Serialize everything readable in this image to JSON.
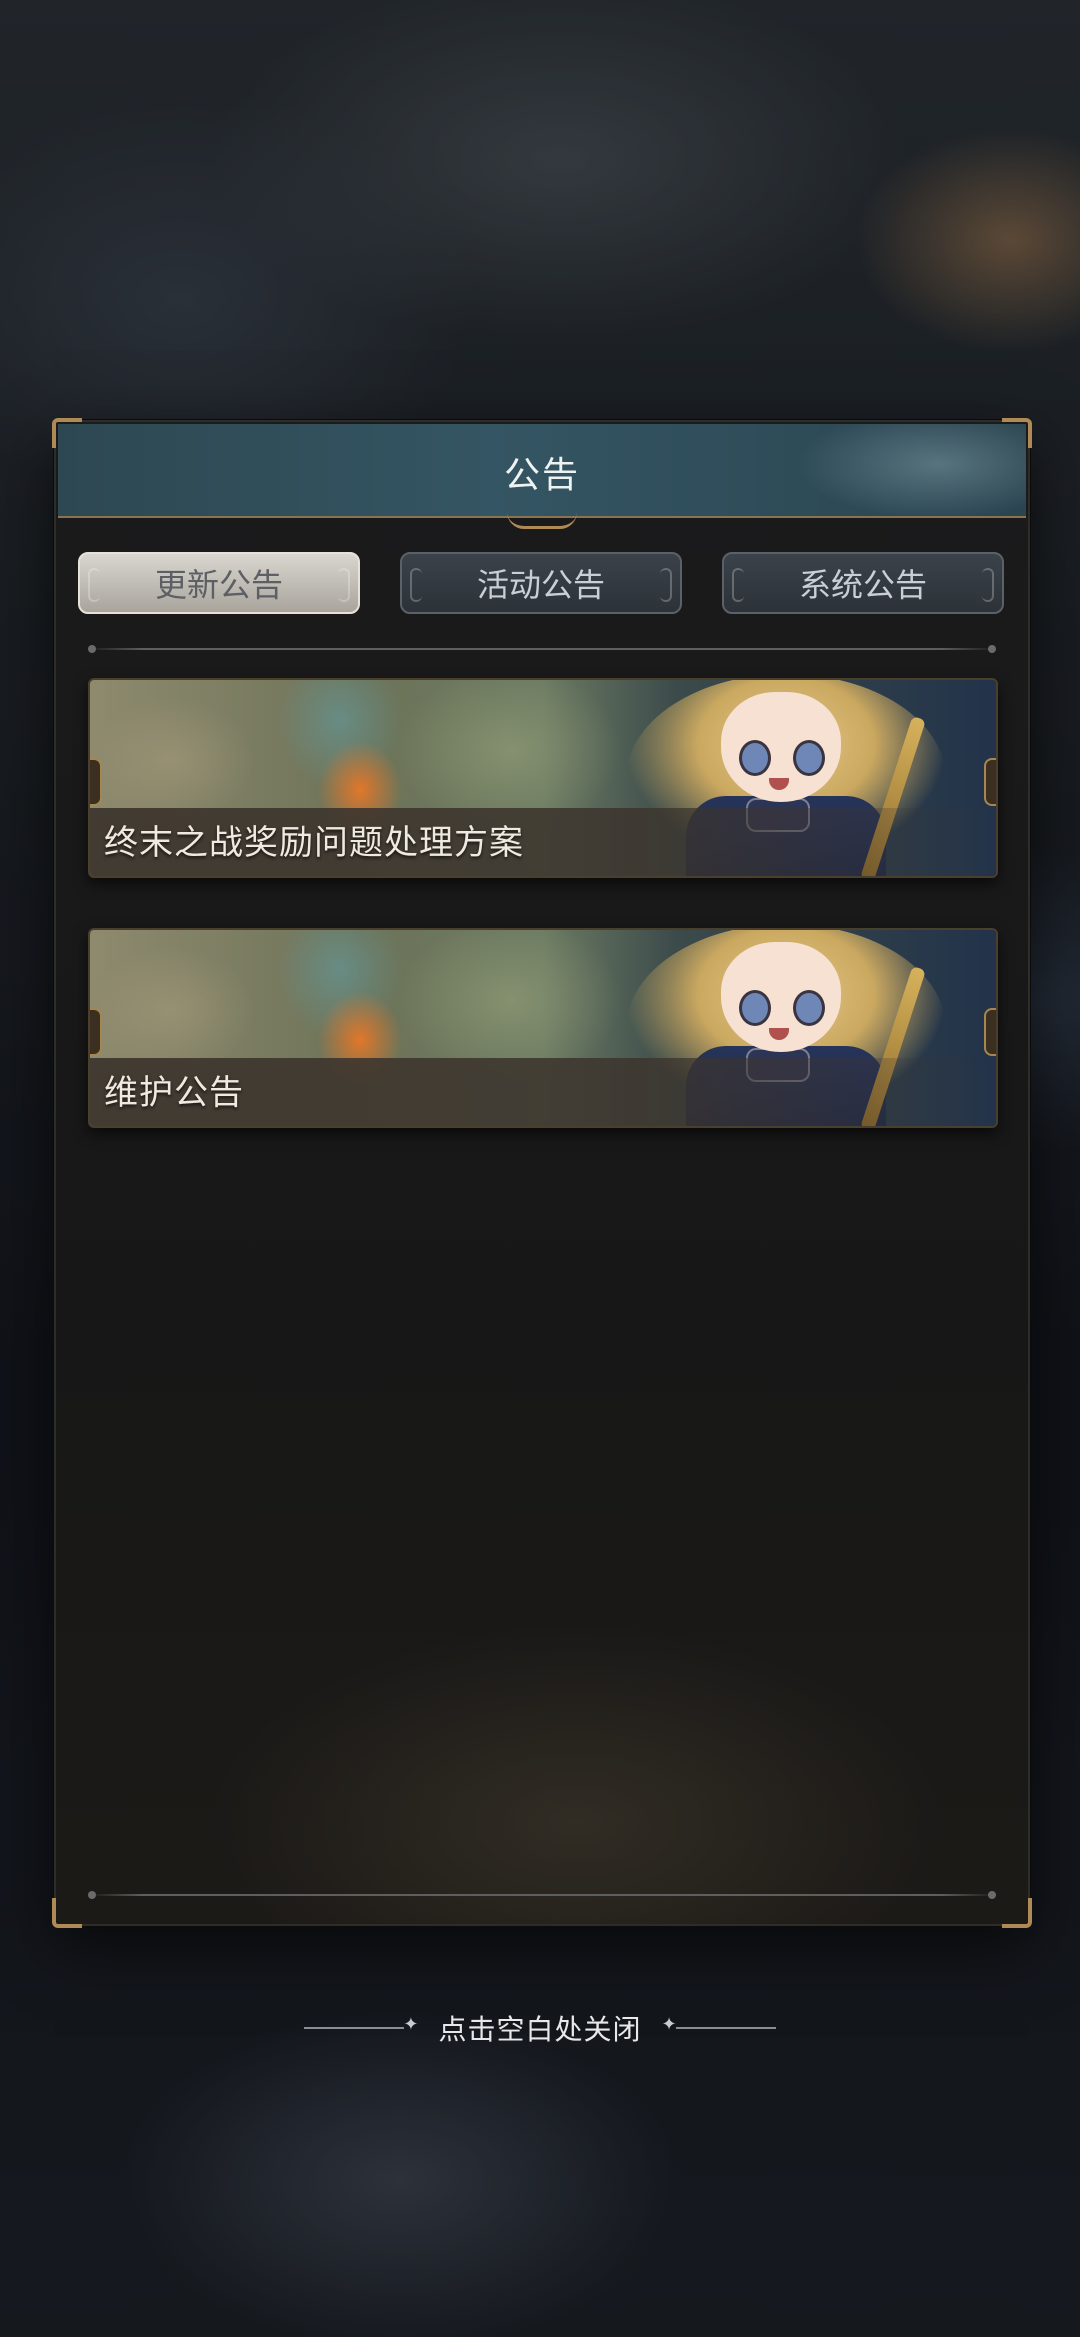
{
  "panel": {
    "title": "公告"
  },
  "tabs": [
    {
      "label": "更新公告",
      "active": true
    },
    {
      "label": "活动公告",
      "active": false
    },
    {
      "label": "系统公告",
      "active": false
    }
  ],
  "notices": [
    {
      "title": "终末之战奖励问题处理方案"
    },
    {
      "title": "维护公告"
    }
  ],
  "footer": {
    "close_hint": "点击空白处关闭"
  },
  "colors": {
    "header_bg": "#345563",
    "active_tab": "#d9d6cf",
    "inactive_tab": "#2c3238",
    "gold_trim": "#b08a55"
  }
}
